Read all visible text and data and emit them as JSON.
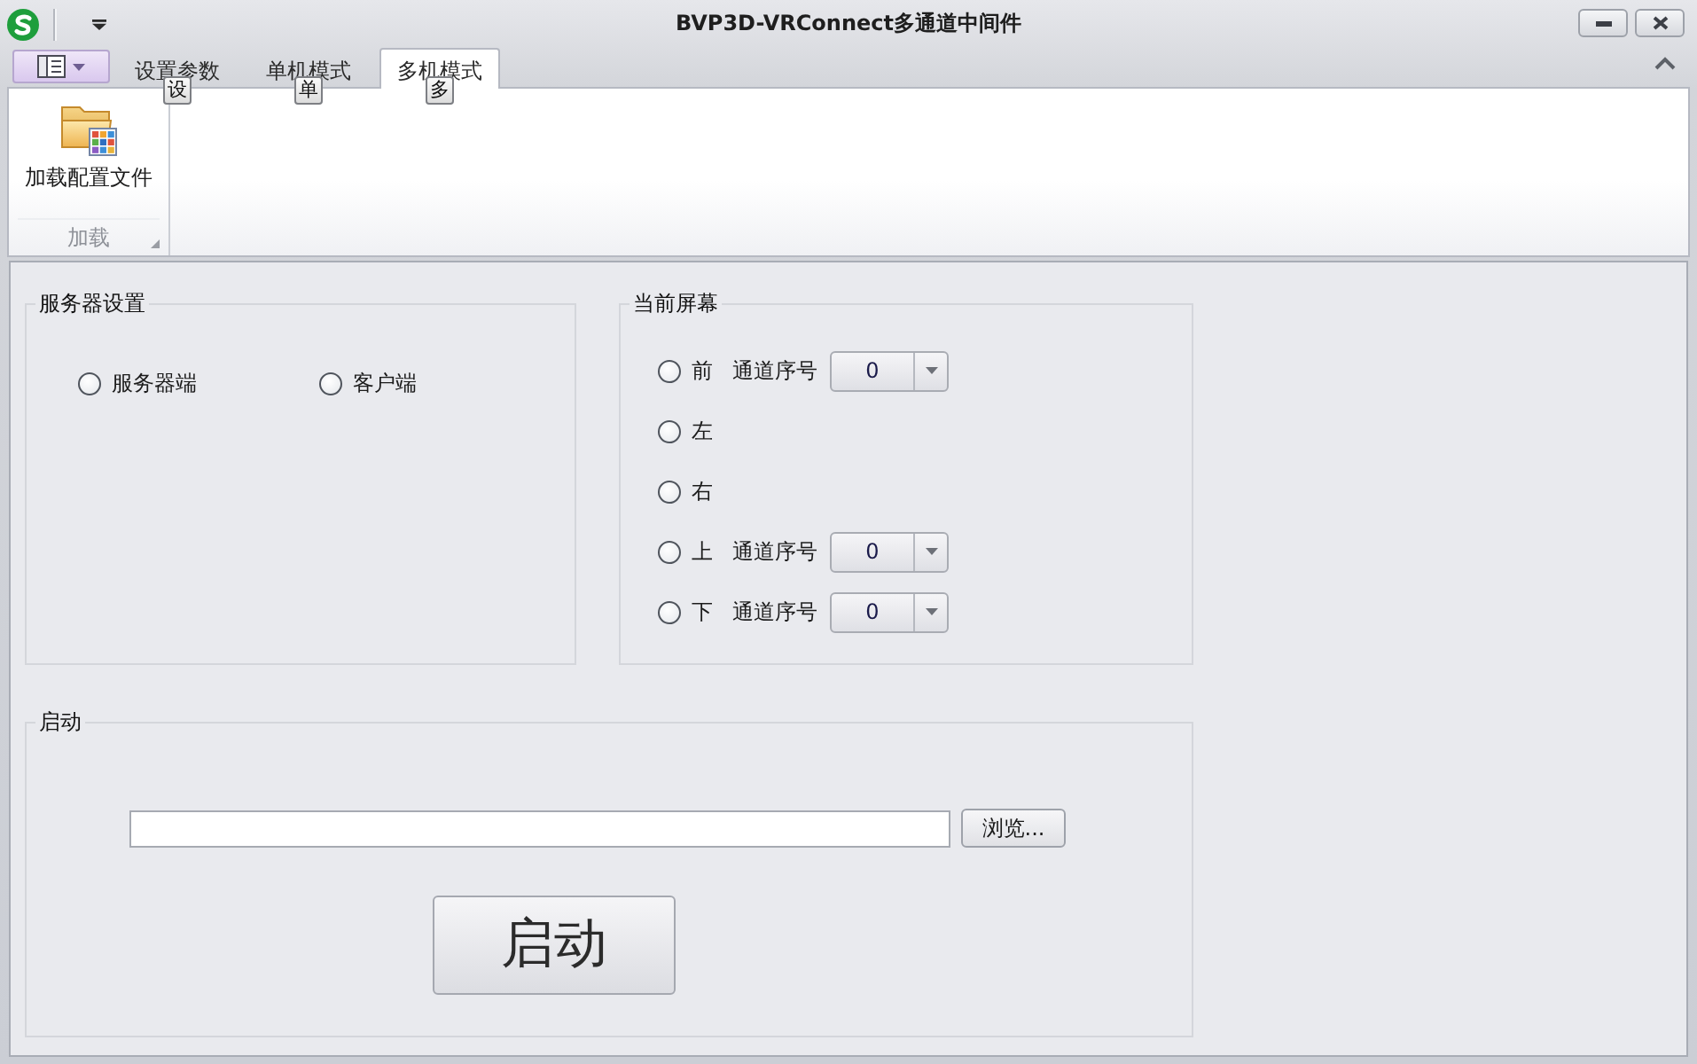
{
  "window": {
    "title": "BVP3D-VRConnect多通道中间件"
  },
  "ribbon": {
    "tabs": [
      {
        "label": "设置参数",
        "keytip": "设",
        "selected": false
      },
      {
        "label": "单机模式",
        "keytip": "单",
        "selected": false
      },
      {
        "label": "多机模式",
        "keytip": "多",
        "selected": true
      }
    ],
    "groups": [
      {
        "label": "加载",
        "buttons": [
          {
            "label": "加载配置文件"
          }
        ]
      }
    ]
  },
  "server_settings": {
    "title": "服务器设置",
    "options": [
      {
        "label": "服务器端",
        "selected": false
      },
      {
        "label": "客户端",
        "selected": false
      }
    ]
  },
  "current_screen": {
    "title": "当前屏幕",
    "options": [
      {
        "label": "前",
        "selected": false,
        "channel": {
          "label": "通道序号",
          "value": "0"
        }
      },
      {
        "label": "左",
        "selected": false
      },
      {
        "label": "右",
        "selected": false
      },
      {
        "label": "上",
        "selected": false,
        "channel": {
          "label": "通道序号",
          "value": "0"
        }
      },
      {
        "label": "下",
        "selected": false,
        "channel": {
          "label": "通道序号",
          "value": "0"
        }
      }
    ]
  },
  "launch": {
    "title": "启动",
    "browse_button": "浏览...",
    "start_button": "启动"
  }
}
